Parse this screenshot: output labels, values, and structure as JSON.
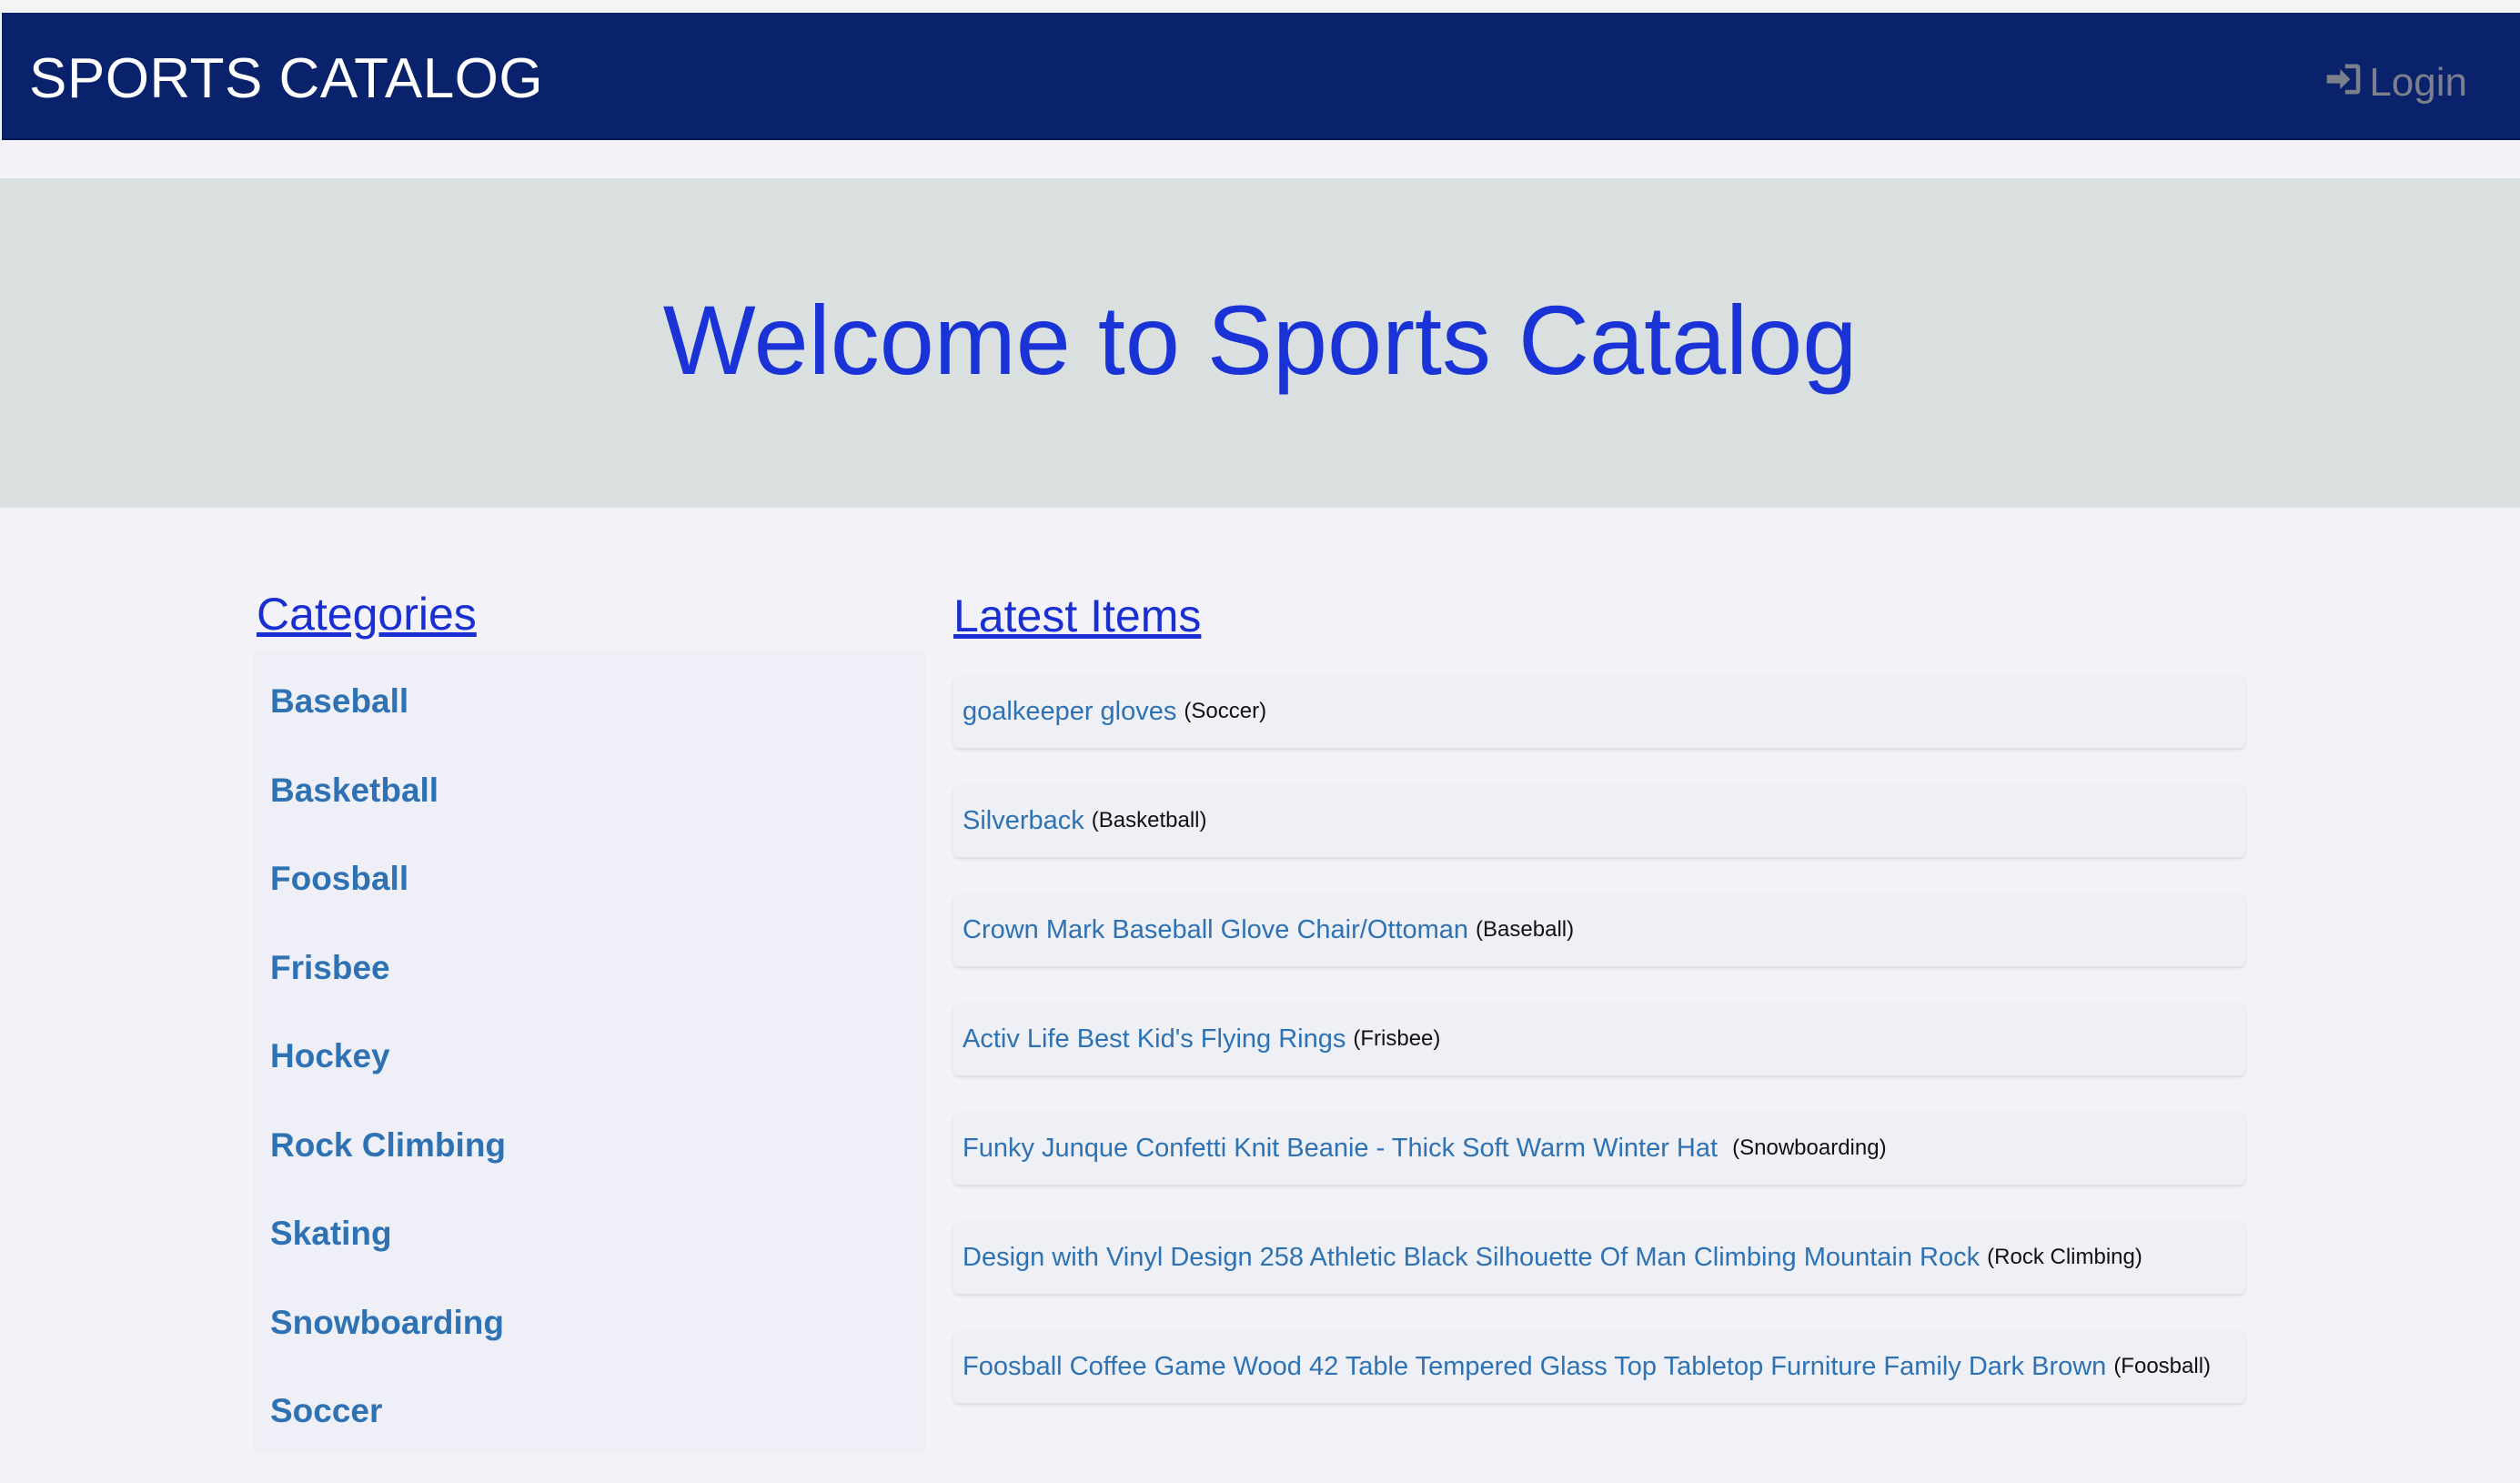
{
  "navbar": {
    "brand": "SPORTS CATALOG",
    "login_label": "Login",
    "login_icon": "sign-in-icon"
  },
  "hero": {
    "title": "Welcome to Sports Catalog"
  },
  "categories": {
    "title": "Categories",
    "items": [
      "Baseball",
      "Basketball",
      "Foosball",
      "Frisbee",
      "Hockey",
      "Rock Climbing",
      "Skating",
      "Snowboarding",
      "Soccer"
    ]
  },
  "latest": {
    "title": "Latest Items",
    "items": [
      {
        "name": "goalkeeper gloves",
        "category": "(Soccer)"
      },
      {
        "name": "Silverback",
        "category": "(Basketball)"
      },
      {
        "name": "Crown Mark Baseball Glove Chair/Ottoman",
        "category": "(Baseball)"
      },
      {
        "name": "Activ Life Best Kid's Flying Rings",
        "category": "(Frisbee)"
      },
      {
        "name": "Funky Junque Confetti Knit Beanie - Thick Soft Warm Winter Hat ",
        "category": "(Snowboarding)"
      },
      {
        "name": "Design with Vinyl Design 258 Athletic Black Silhouette Of Man Climbing Mountain Rock",
        "category": "(Rock Climbing)"
      },
      {
        "name": "Foosball Coffee Game Wood 42 Table Tempered Glass Top Tabletop Furniture Family Dark Brown",
        "category": "(Foosball)"
      }
    ]
  },
  "colors": {
    "navbar_bg": "#0a216b",
    "hero_bg": "#d9e0df",
    "hero_title": "#1a33d6",
    "link": "#2e72b3"
  }
}
